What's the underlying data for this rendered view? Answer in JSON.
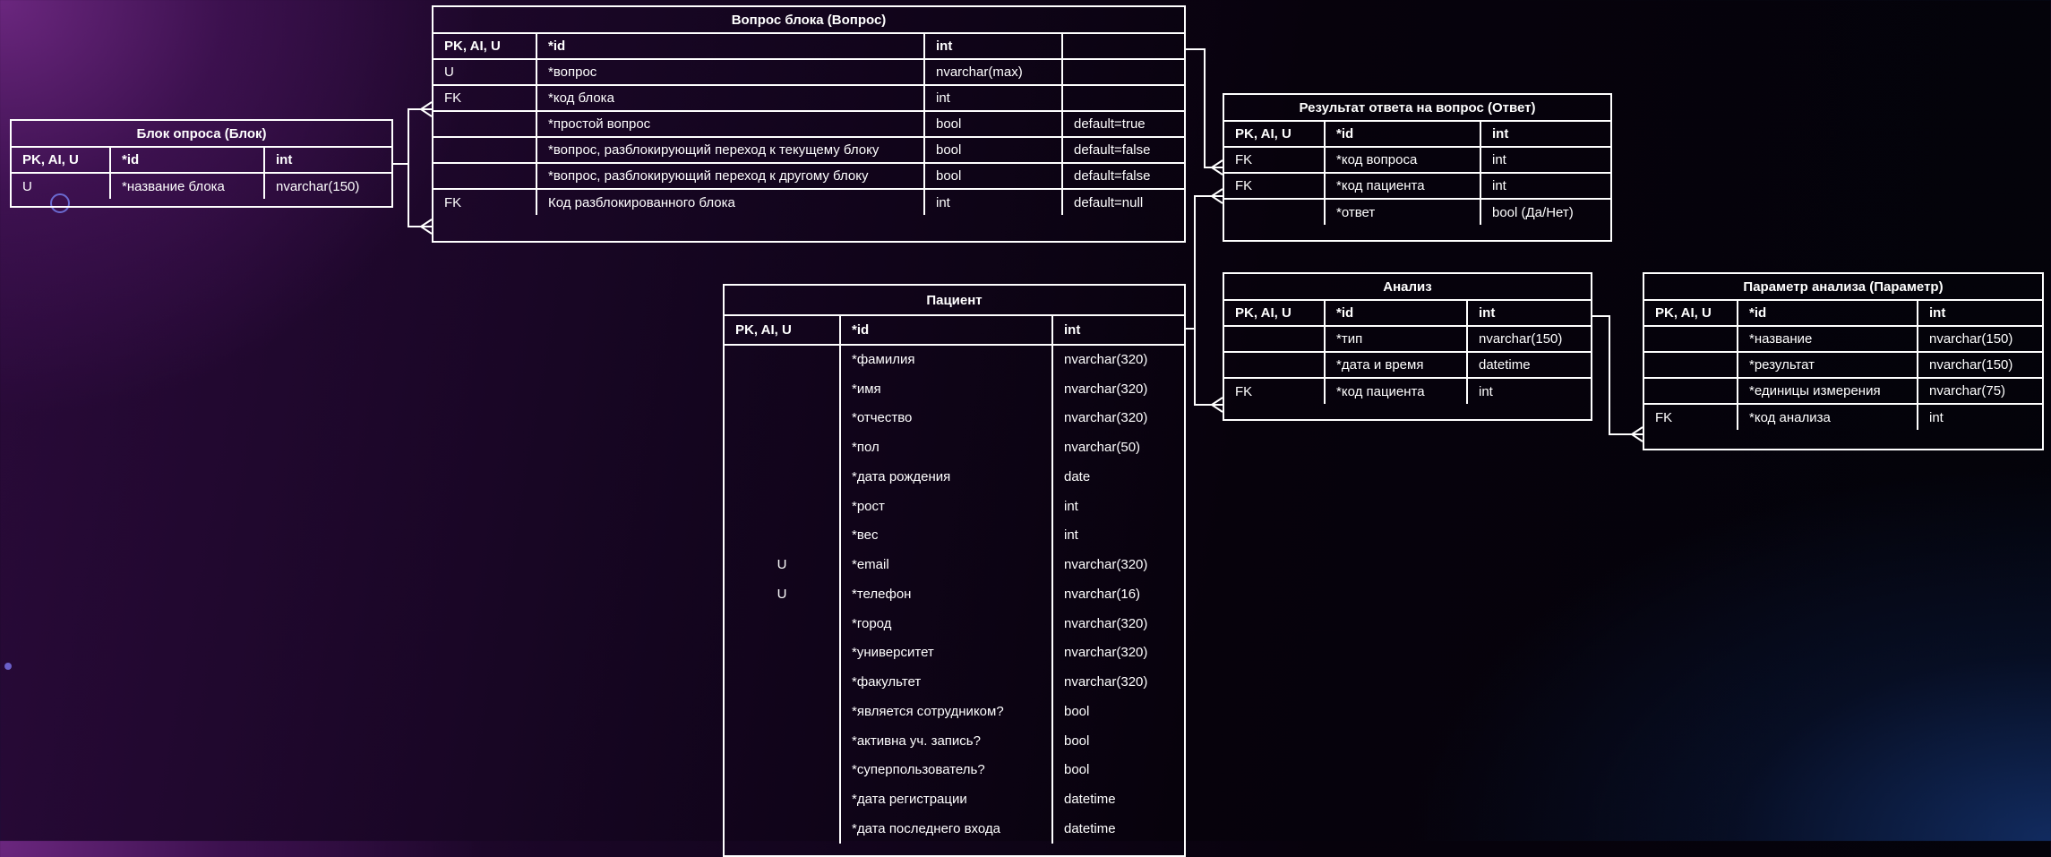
{
  "entities": {
    "block": {
      "title": "Блок опроса (Блок)",
      "header": [
        "PK, AI, U",
        "*id",
        "int"
      ],
      "rows": [
        [
          "U",
          "*название блока",
          "nvarchar(150)"
        ]
      ]
    },
    "question": {
      "title": "Вопрос блока (Вопрос)",
      "header": [
        "PK, AI, U",
        "*id",
        "int",
        ""
      ],
      "rows": [
        [
          "U",
          "*вопрос",
          "nvarchar(max)",
          ""
        ],
        [
          "FK",
          "*код блока",
          "int",
          ""
        ],
        [
          "",
          "*простой вопрос",
          "bool",
          "default=true"
        ],
        [
          "",
          "*вопрос, разблокирующий переход к текущему блоку",
          "bool",
          "default=false"
        ],
        [
          "",
          "*вопрос, разблокирующий переход к другому блоку",
          "bool",
          "default=false"
        ],
        [
          "FK",
          "Код разблокированного блока",
          "int",
          "default=null"
        ]
      ]
    },
    "answer": {
      "title": "Результат ответа на вопрос (Ответ)",
      "header": [
        "PK, AI, U",
        "*id",
        "int"
      ],
      "rows": [
        [
          "FK",
          "*код вопроса",
          "int"
        ],
        [
          "FK",
          "*код пациента",
          "int"
        ],
        [
          "",
          "*ответ",
          "bool (Да/Нет)"
        ]
      ]
    },
    "patient": {
      "title": "Пациент",
      "header": [
        "PK, AI, U",
        "*id",
        "int"
      ],
      "rows": [
        [
          "",
          "*фамилия",
          "nvarchar(320)"
        ],
        [
          "",
          "*имя",
          "nvarchar(320)"
        ],
        [
          "",
          "*отчество",
          "nvarchar(320)"
        ],
        [
          "",
          "*пол",
          "nvarchar(50)"
        ],
        [
          "",
          "*дата рождения",
          "date"
        ],
        [
          "",
          "*рост",
          "int"
        ],
        [
          "",
          "*вес",
          "int"
        ],
        [
          "U",
          "*email",
          "nvarchar(320)"
        ],
        [
          "U",
          "*телефон",
          "nvarchar(16)"
        ],
        [
          "",
          "*город",
          "nvarchar(320)"
        ],
        [
          "",
          "*университет",
          "nvarchar(320)"
        ],
        [
          "",
          "*факультет",
          "nvarchar(320)"
        ],
        [
          "",
          "*является сотрудником?",
          "bool"
        ],
        [
          "",
          "*активна уч. запись?",
          "bool"
        ],
        [
          "",
          "*суперпользователь?",
          "bool"
        ],
        [
          "",
          "*дата регистрации",
          "datetime"
        ],
        [
          "",
          "*дата последнего  входа",
          "datetime"
        ]
      ]
    },
    "analysis": {
      "title": "Анализ",
      "header": [
        "PK, AI, U",
        "*id",
        "int"
      ],
      "rows": [
        [
          "",
          "*тип",
          "nvarchar(150)"
        ],
        [
          "",
          "*дата и время",
          "datetime"
        ],
        [
          "FK",
          "*код пациента",
          "int"
        ]
      ]
    },
    "param": {
      "title": "Параметр анализа (Параметр)",
      "header": [
        "PK, AI, U",
        "*id",
        "int"
      ],
      "rows": [
        [
          "",
          "*название",
          "nvarchar(150)"
        ],
        [
          "",
          "*результат",
          "nvarchar(150)"
        ],
        [
          "",
          "*единицы измерения",
          "nvarchar(75)"
        ],
        [
          "FK",
          "*код анализа",
          "int"
        ]
      ]
    }
  }
}
